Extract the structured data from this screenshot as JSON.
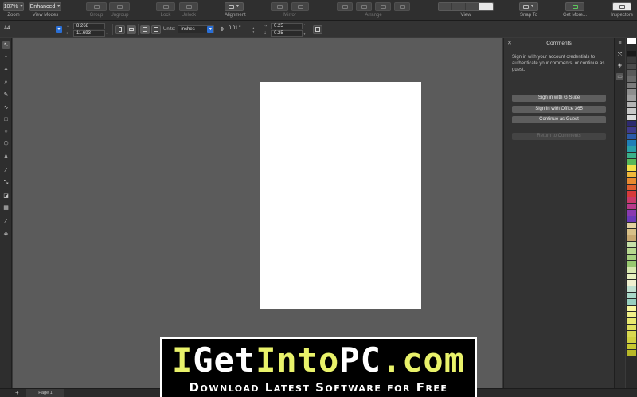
{
  "toolbar": {
    "zoom": {
      "value": "107%",
      "label": "Zoom"
    },
    "view_modes": {
      "value": "Enhanced",
      "label": "View Modes"
    },
    "group_label": "Group",
    "ungroup_label": "Ungroup",
    "lock_label": "Lock",
    "unlock_label": "Unlock",
    "alignment_label": "Alignment",
    "mirror_label": "Mirror",
    "arrange_label": "Arrange",
    "view_label": "View",
    "snap_to_label": "Snap To",
    "get_more_label": "Get More...",
    "inspectors_label": "Inspectors"
  },
  "propbar": {
    "page_size": "A4",
    "width": "8.268",
    "height": "11.693",
    "units_label": "Units:",
    "units_value": "inches",
    "nudge": "0.01 \"",
    "dup_x": "0.25",
    "dup_y": "0.25"
  },
  "comments": {
    "title": "Comments",
    "message": "Sign in with your account credentials to authenticate your comments, or continue as guest.",
    "btn_gsuite": "Sign in with G Suite",
    "btn_office": "Sign in with Office 365",
    "btn_guest": "Continue as Guest",
    "btn_return": "Return to Comments"
  },
  "bottom": {
    "page_tab": "Page 1"
  },
  "palette": [
    "#ffffff",
    "#2a2a2a",
    "#1a1a1a",
    "#3a3a3a",
    "#4a4a4a",
    "#5a5a5a",
    "#6a6a6a",
    "#7c7c7c",
    "#8e8e8e",
    "#a0a0a0",
    "#b4b4b4",
    "#c8c8c8",
    "#dcdcdc",
    "#2e2a6e",
    "#3f3a8a",
    "#2b5aa8",
    "#1f7fb8",
    "#2aa0a8",
    "#3ab08a",
    "#5ab85a",
    "#f4e04a",
    "#f0b83a",
    "#e88a30",
    "#e06030",
    "#d83a3a",
    "#c83a6a",
    "#b83a8a",
    "#8a3ab0",
    "#6a3ab8",
    "#e0d0a0",
    "#d8c088",
    "#c8a870",
    "#c6e0a8",
    "#b8d890",
    "#a8d080",
    "#98c870",
    "#d8e8b0",
    "#e8f0c0",
    "#f0f0d0",
    "#c0e0d0",
    "#a8d8c8",
    "#98d0c0",
    "#f8f8a0",
    "#f0f088",
    "#e8e870",
    "#e0e060",
    "#d8d850",
    "#d0d040",
    "#c8c830",
    "#b8b828"
  ],
  "watermark": {
    "brand_part1": "I",
    "brand_part2": "Get",
    "brand_part3": "Into",
    "brand_part4": "PC",
    "brand_part5": ".com",
    "tagline": "Download Latest Software for Free"
  }
}
